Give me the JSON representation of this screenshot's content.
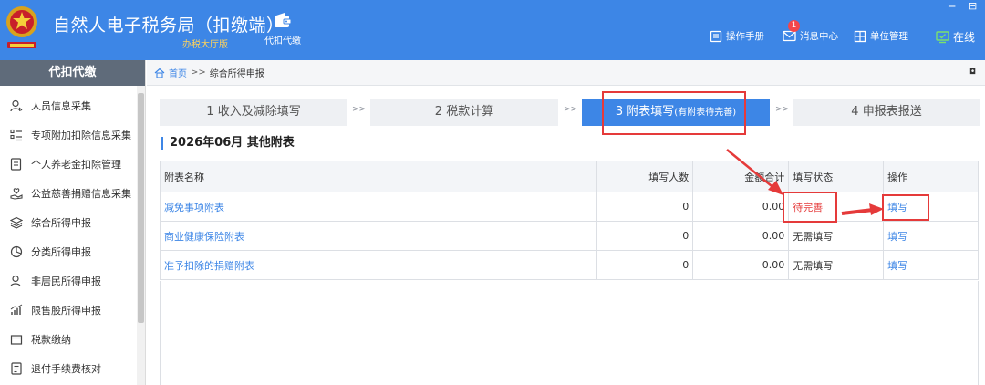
{
  "header": {
    "app_title": "自然人电子税务局（扣缴端）",
    "app_subtitle": "办税大厅版",
    "module_label": "代扣代缴",
    "manual": "操作手册",
    "messages": "消息中心",
    "messages_count": "1",
    "unit": "单位管理",
    "online": "在线",
    "min_icon": "─",
    "max_icon": "⊟"
  },
  "sidebar": {
    "title": "代扣代缴",
    "items": [
      {
        "label": "人员信息采集",
        "icon": "person-icon"
      },
      {
        "label": "专项附加扣除信息采集",
        "icon": "list-icon"
      },
      {
        "label": "个人养老金扣除管理",
        "icon": "document-icon"
      },
      {
        "label": "公益慈善捐赠信息采集",
        "icon": "heart-hand-icon"
      },
      {
        "label": "综合所得申报",
        "icon": "layers-icon"
      },
      {
        "label": "分类所得申报",
        "icon": "pie-icon"
      },
      {
        "label": "非居民所得申报",
        "icon": "user-icon"
      },
      {
        "label": "限售股所得申报",
        "icon": "chart-icon"
      },
      {
        "label": "税款缴纳",
        "icon": "folder-icon"
      },
      {
        "label": "退付手续费核对",
        "icon": "receipt-icon"
      }
    ]
  },
  "breadcrumb": {
    "home": "首页",
    "sep": ">>",
    "current": "综合所得申报",
    "close": "◘"
  },
  "steps": [
    {
      "label": "1 收入及减除填写"
    },
    {
      "label": "2 税款计算"
    },
    {
      "label": "3 附表填写",
      "sub": "(有附表待完善)"
    },
    {
      "label": "4 申报表报送"
    }
  ],
  "step_sep": ">>",
  "section_title": "2026年06月 其他附表",
  "table": {
    "headers": [
      "附表名称",
      "填写人数",
      "金额合计",
      "填写状态",
      "操作"
    ],
    "rows": [
      {
        "name": "减免事项附表",
        "count": "0",
        "amount": "0.00",
        "status": "待完善",
        "action": "填写"
      },
      {
        "name": "商业健康保险附表",
        "count": "0",
        "amount": "0.00",
        "status": "无需填写",
        "action": "填写"
      },
      {
        "name": "准予扣除的捐赠附表",
        "count": "0",
        "amount": "0.00",
        "status": "无需填写",
        "action": "填写"
      }
    ]
  },
  "colors": {
    "brand": "#3d86e6",
    "highlight": "#e53a3a",
    "sidebar_head": "#5f6b7a"
  }
}
